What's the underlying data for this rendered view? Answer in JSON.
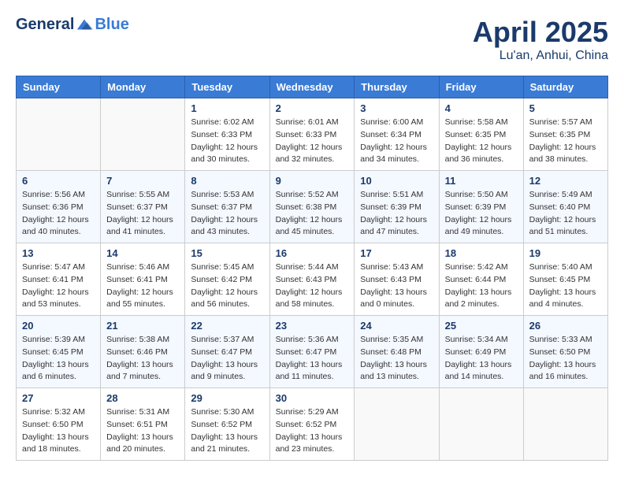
{
  "header": {
    "logo_general": "General",
    "logo_blue": "Blue",
    "title": "April 2025",
    "subtitle": "Lu'an, Anhui, China"
  },
  "days_of_week": [
    "Sunday",
    "Monday",
    "Tuesday",
    "Wednesday",
    "Thursday",
    "Friday",
    "Saturday"
  ],
  "weeks": [
    [
      {
        "day": "",
        "info": ""
      },
      {
        "day": "",
        "info": ""
      },
      {
        "day": "1",
        "info": "Sunrise: 6:02 AM\nSunset: 6:33 PM\nDaylight: 12 hours and 30 minutes."
      },
      {
        "day": "2",
        "info": "Sunrise: 6:01 AM\nSunset: 6:33 PM\nDaylight: 12 hours and 32 minutes."
      },
      {
        "day": "3",
        "info": "Sunrise: 6:00 AM\nSunset: 6:34 PM\nDaylight: 12 hours and 34 minutes."
      },
      {
        "day": "4",
        "info": "Sunrise: 5:58 AM\nSunset: 6:35 PM\nDaylight: 12 hours and 36 minutes."
      },
      {
        "day": "5",
        "info": "Sunrise: 5:57 AM\nSunset: 6:35 PM\nDaylight: 12 hours and 38 minutes."
      }
    ],
    [
      {
        "day": "6",
        "info": "Sunrise: 5:56 AM\nSunset: 6:36 PM\nDaylight: 12 hours and 40 minutes."
      },
      {
        "day": "7",
        "info": "Sunrise: 5:55 AM\nSunset: 6:37 PM\nDaylight: 12 hours and 41 minutes."
      },
      {
        "day": "8",
        "info": "Sunrise: 5:53 AM\nSunset: 6:37 PM\nDaylight: 12 hours and 43 minutes."
      },
      {
        "day": "9",
        "info": "Sunrise: 5:52 AM\nSunset: 6:38 PM\nDaylight: 12 hours and 45 minutes."
      },
      {
        "day": "10",
        "info": "Sunrise: 5:51 AM\nSunset: 6:39 PM\nDaylight: 12 hours and 47 minutes."
      },
      {
        "day": "11",
        "info": "Sunrise: 5:50 AM\nSunset: 6:39 PM\nDaylight: 12 hours and 49 minutes."
      },
      {
        "day": "12",
        "info": "Sunrise: 5:49 AM\nSunset: 6:40 PM\nDaylight: 12 hours and 51 minutes."
      }
    ],
    [
      {
        "day": "13",
        "info": "Sunrise: 5:47 AM\nSunset: 6:41 PM\nDaylight: 12 hours and 53 minutes."
      },
      {
        "day": "14",
        "info": "Sunrise: 5:46 AM\nSunset: 6:41 PM\nDaylight: 12 hours and 55 minutes."
      },
      {
        "day": "15",
        "info": "Sunrise: 5:45 AM\nSunset: 6:42 PM\nDaylight: 12 hours and 56 minutes."
      },
      {
        "day": "16",
        "info": "Sunrise: 5:44 AM\nSunset: 6:43 PM\nDaylight: 12 hours and 58 minutes."
      },
      {
        "day": "17",
        "info": "Sunrise: 5:43 AM\nSunset: 6:43 PM\nDaylight: 13 hours and 0 minutes."
      },
      {
        "day": "18",
        "info": "Sunrise: 5:42 AM\nSunset: 6:44 PM\nDaylight: 13 hours and 2 minutes."
      },
      {
        "day": "19",
        "info": "Sunrise: 5:40 AM\nSunset: 6:45 PM\nDaylight: 13 hours and 4 minutes."
      }
    ],
    [
      {
        "day": "20",
        "info": "Sunrise: 5:39 AM\nSunset: 6:45 PM\nDaylight: 13 hours and 6 minutes."
      },
      {
        "day": "21",
        "info": "Sunrise: 5:38 AM\nSunset: 6:46 PM\nDaylight: 13 hours and 7 minutes."
      },
      {
        "day": "22",
        "info": "Sunrise: 5:37 AM\nSunset: 6:47 PM\nDaylight: 13 hours and 9 minutes."
      },
      {
        "day": "23",
        "info": "Sunrise: 5:36 AM\nSunset: 6:47 PM\nDaylight: 13 hours and 11 minutes."
      },
      {
        "day": "24",
        "info": "Sunrise: 5:35 AM\nSunset: 6:48 PM\nDaylight: 13 hours and 13 minutes."
      },
      {
        "day": "25",
        "info": "Sunrise: 5:34 AM\nSunset: 6:49 PM\nDaylight: 13 hours and 14 minutes."
      },
      {
        "day": "26",
        "info": "Sunrise: 5:33 AM\nSunset: 6:50 PM\nDaylight: 13 hours and 16 minutes."
      }
    ],
    [
      {
        "day": "27",
        "info": "Sunrise: 5:32 AM\nSunset: 6:50 PM\nDaylight: 13 hours and 18 minutes."
      },
      {
        "day": "28",
        "info": "Sunrise: 5:31 AM\nSunset: 6:51 PM\nDaylight: 13 hours and 20 minutes."
      },
      {
        "day": "29",
        "info": "Sunrise: 5:30 AM\nSunset: 6:52 PM\nDaylight: 13 hours and 21 minutes."
      },
      {
        "day": "30",
        "info": "Sunrise: 5:29 AM\nSunset: 6:52 PM\nDaylight: 13 hours and 23 minutes."
      },
      {
        "day": "",
        "info": ""
      },
      {
        "day": "",
        "info": ""
      },
      {
        "day": "",
        "info": ""
      }
    ]
  ]
}
